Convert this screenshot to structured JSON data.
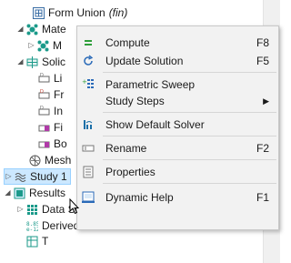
{
  "tree": {
    "form_union_label": "Form Union",
    "form_union_suffix": "(fin)",
    "materials_label": "Mate",
    "materials_child_label": "M",
    "solid_label": "Solic",
    "solid_children": [
      "Li",
      "Fr",
      "In",
      "Fi",
      "Bo"
    ],
    "mesh_label": "Mesh",
    "study_label": "Study 1",
    "results_label": "Results",
    "data_sets_label": "Data Sets",
    "derived_values_label": "Derived Values",
    "tables_label": "T"
  },
  "context_menu": {
    "items": [
      {
        "label": "Compute",
        "shortcut": "F8",
        "icon": "compute-icon"
      },
      {
        "label": "Update Solution",
        "shortcut": "F5",
        "icon": "update-solution-icon"
      },
      {
        "label": "Parametric Sweep",
        "shortcut": "",
        "icon": "parametric-sweep-icon"
      },
      {
        "label": "Study Steps",
        "shortcut": "",
        "icon": "",
        "submenu": true
      },
      {
        "label": "Show Default Solver",
        "shortcut": "",
        "icon": "solver-icon"
      },
      {
        "label": "Rename",
        "shortcut": "F2",
        "icon": "rename-icon"
      },
      {
        "label": "Properties",
        "shortcut": "",
        "icon": "properties-icon"
      },
      {
        "label": "Dynamic Help",
        "shortcut": "F1",
        "icon": "help-icon"
      }
    ]
  },
  "colors": {
    "selection": "#cce8ff",
    "menu_bg": "#f2f2f2",
    "compute_green": "#2e9e3a",
    "teal": "#1b9a8a"
  }
}
